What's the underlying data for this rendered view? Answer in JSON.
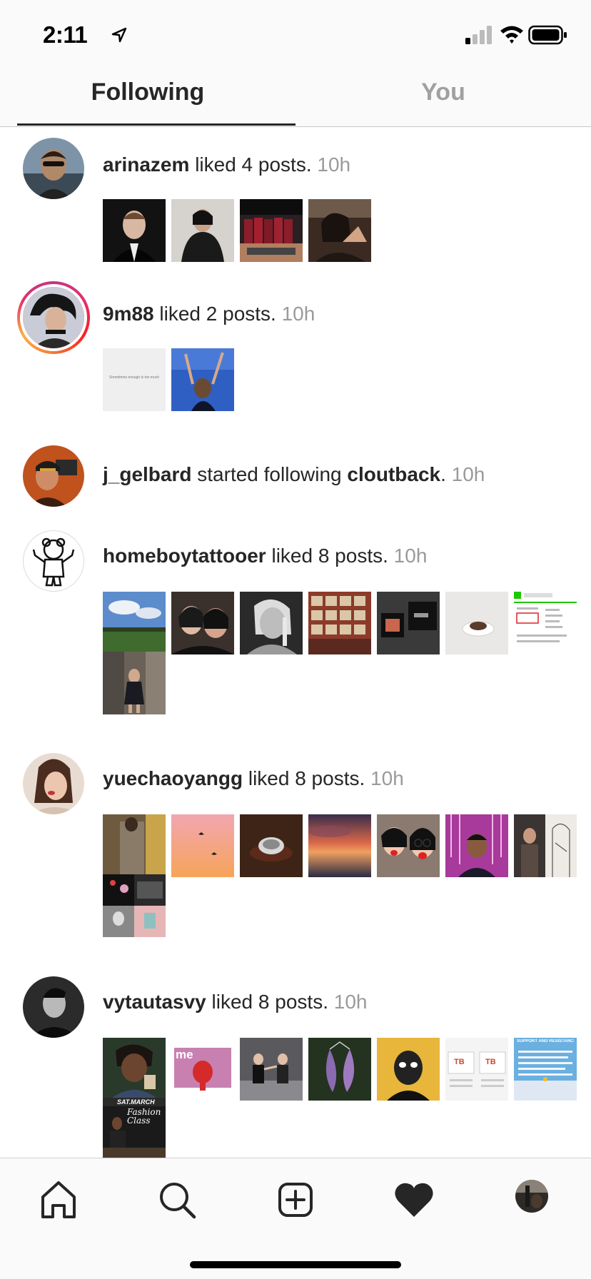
{
  "status_bar": {
    "time": "2:11"
  },
  "tabs": {
    "following": "Following",
    "you": "You"
  },
  "activity": [
    {
      "user": "arinazem",
      "action": "liked 4 posts.",
      "target": "",
      "target_suffix": "",
      "time": "10h",
      "thumbs": 4
    },
    {
      "user": "9m88",
      "action": "liked 2 posts.",
      "target": "",
      "target_suffix": "",
      "time": "10h",
      "thumbs": 2
    },
    {
      "user": "j_gelbard",
      "action": "started following",
      "target": "cloutback",
      "target_suffix": ".",
      "time": "10h",
      "thumbs": 0
    },
    {
      "user": "homeboytattooer",
      "action": "liked 8 posts.",
      "target": "",
      "target_suffix": "",
      "time": "10h",
      "thumbs": 8
    },
    {
      "user": "yuechaoyangg",
      "action": "liked 8 posts.",
      "target": "",
      "target_suffix": "",
      "time": "10h",
      "thumbs": 8
    },
    {
      "user": "vytautasvy",
      "action": "liked 8 posts.",
      "target": "",
      "target_suffix": "",
      "time": "10h",
      "thumbs": 8
    }
  ],
  "thumb_texts": {
    "quote_post": "Sometimes enough is too much",
    "sat_march": "SAT.MARCH",
    "fashion_class": "Fashion Class",
    "sign_text": "SUPPORT AND RESISTANCE",
    "me_text": "me",
    "tb_text": "TB"
  },
  "nav": {
    "icons": [
      "home-icon",
      "search-icon",
      "new-post-icon",
      "activity-heart-icon",
      "profile-avatar"
    ]
  }
}
